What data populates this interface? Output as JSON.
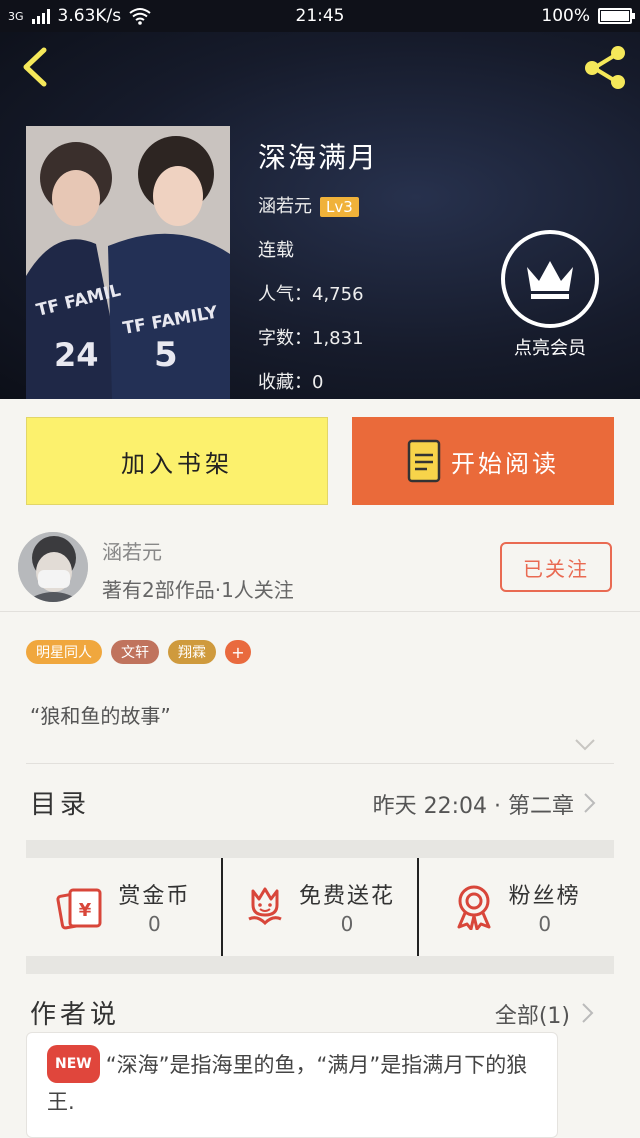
{
  "status_bar": {
    "network": "3G",
    "speed": "3.63K/s",
    "time": "21:45",
    "battery": "100%"
  },
  "book": {
    "title": "深海满月",
    "author": "涵若元",
    "level": "Lv3",
    "status": "连载",
    "popularity": "人气：4,756",
    "word_count": "字数：1,831",
    "favorites": "收藏：0",
    "vip_label": "点亮会员"
  },
  "actions": {
    "add_shelf": "加入书架",
    "start_reading": "开始阅读"
  },
  "author": {
    "name": "涵若元",
    "meta": "著有2部作品·1人关注",
    "follow_label": "已关注"
  },
  "tags": [
    {
      "label": "明星同人",
      "color": "#f0a73e"
    },
    {
      "label": "文轩",
      "color": "#c0735d"
    },
    {
      "label": "翔霖",
      "color": "#cf9a3d"
    },
    {
      "label": "+",
      "color": "#e96a3e"
    }
  ],
  "synopsis": "“狼和鱼的故事”",
  "toc": {
    "title": "目录",
    "latest": "昨天 22:04 · 第二章"
  },
  "stats": [
    {
      "label": "赏金币",
      "value": "0",
      "icon": "red-envelope-icon"
    },
    {
      "label": "免费送花",
      "value": "0",
      "icon": "flower-icon"
    },
    {
      "label": "粉丝榜",
      "value": "0",
      "icon": "medal-icon"
    }
  ],
  "author_says": {
    "title": "作者说",
    "all_label": "全部(1)",
    "badge": "NEW",
    "text": "“深海”是指海里的鱼，“满月”是指满月下的狼王."
  },
  "colors": {
    "accent_orange": "#ea6a3a",
    "shelf_yellow": "#fcf16d",
    "icon_red": "#d8463a"
  }
}
